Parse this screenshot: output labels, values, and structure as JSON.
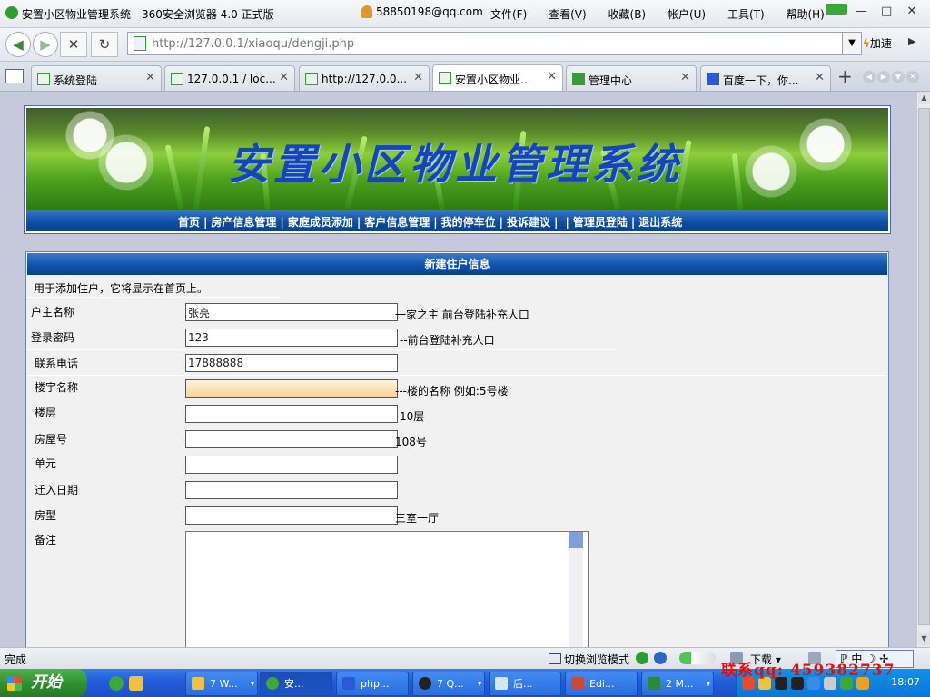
{
  "window": {
    "title": "安置小区物业管理系统 - 360安全浏览器 4.0 正式版",
    "user_email": "58850198@qq.com",
    "menu": [
      "文件(F)",
      "查看(V)",
      "收藏(B)",
      "帐户(U)",
      "工具(T)",
      "帮助(H)"
    ],
    "controls": [
      "—",
      "□",
      "✕"
    ]
  },
  "address": {
    "url": "http://127.0.0.1/xiaoqu/dengji.php",
    "accelerate_label": "加速"
  },
  "tabs": [
    {
      "label": "系统登陆",
      "active": false
    },
    {
      "label": "127.0.0.1 / loc...",
      "active": false
    },
    {
      "label": "http://127.0.0...",
      "active": false
    },
    {
      "label": "安置小区物业...",
      "active": true
    },
    {
      "label": "管理中心",
      "active": false
    },
    {
      "label": "百度一下，你...",
      "active": false
    }
  ],
  "banner": {
    "title": "安置小区物业管理系统",
    "nav": [
      "首页",
      "房产信息管理",
      "家庭成员添加",
      "客户信息管理",
      "我的停车位",
      "投诉建议",
      "",
      "管理员登陆",
      "退出系统"
    ]
  },
  "form": {
    "header": "新建住户信息",
    "description": "用于添加住户，它将显示在首页上。",
    "fields": {
      "owner_name": {
        "label": "户主名称",
        "value": "张亮",
        "hint": "一家之主 前台登陆补充人口"
      },
      "password": {
        "label": "登录密码",
        "value": "123",
        "hint": "--前台登陆补充人口"
      },
      "phone": {
        "label": "联系电话",
        "value": "17888888",
        "hint": ""
      },
      "building": {
        "label": "楼宇名称",
        "value": "",
        "hint": "---楼的名称 例如:5号楼"
      },
      "floor": {
        "label": "楼层",
        "value": "",
        "hint": "10层"
      },
      "room": {
        "label": "房屋号",
        "value": "",
        "hint": "108号"
      },
      "unit": {
        "label": "单元",
        "value": "",
        "hint": ""
      },
      "move_in_date": {
        "label": "迁入日期",
        "value": "",
        "hint": ""
      },
      "layout": {
        "label": "房型",
        "value": "",
        "hint": "三室一厅"
      },
      "remark": {
        "label": "备注",
        "value": ""
      }
    }
  },
  "status": {
    "text": "完成",
    "mode_label": "切换浏览模式",
    "download_label": "下载",
    "ime_label": "中"
  },
  "taskbar": {
    "start_label": "开始",
    "tasks": [
      "7 W...",
      "安...",
      "php...",
      "7 Q...",
      "后...",
      "Edi...",
      "2 M..."
    ],
    "clock": "18:07",
    "overlay_qq": "联系qq: 459382737"
  },
  "colors": {
    "nav_blue": "#1053ae",
    "banner_title": "#1446b8",
    "focus_field": "#f7d49a",
    "overlay_red": "#e01010"
  }
}
